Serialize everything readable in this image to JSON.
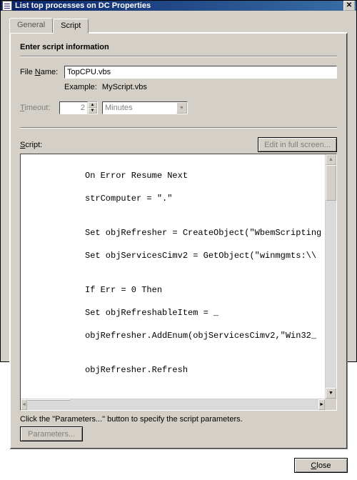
{
  "titlebar": {
    "title": "List top processes on DC Properties",
    "close_label": "✕"
  },
  "tabs": {
    "general": "General",
    "script": "Script"
  },
  "section_title": "Enter script information",
  "filename": {
    "label": "File Name:",
    "value": "TopCPU.vbs",
    "example_label": "Example:",
    "example_value": "MyScript.vbs"
  },
  "timeout": {
    "label": "Timeout:",
    "value": "2",
    "unit": "Minutes"
  },
  "script": {
    "label": "Script:",
    "edit_button": "Edit in full screen...",
    "content_lines": [
      "On Error Resume Next",
      "strComputer = \".\"",
      "",
      "Set objRefresher = CreateObject(\"WbemScripting",
      "Set objServicesCimv2 = GetObject(\"winmgmts:\\\\",
      "",
      "If Err = 0 Then",
      "Set objRefreshableItem = _",
      "objRefresher.AddEnum(objServicesCimv2,\"Win32_",
      "",
      "objRefresher.Refresh"
    ]
  },
  "hint": "Click the \"Parameters...\" button to specify the script parameters.",
  "parameters_button": "Parameters...",
  "close_button": "Close"
}
